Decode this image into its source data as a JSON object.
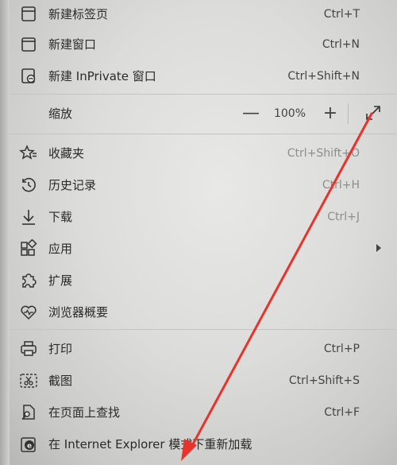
{
  "menu": {
    "items_top": [
      {
        "label": "新建标签页",
        "shortcut": "Ctrl+T"
      },
      {
        "label": "新建窗口",
        "shortcut": "Ctrl+N"
      },
      {
        "label": "新建 InPrivate 窗口",
        "shortcut": "Ctrl+Shift+N"
      }
    ],
    "zoom": {
      "label": "缩放",
      "minus": "—",
      "value": "100%",
      "plus": "+"
    },
    "items_mid": [
      {
        "label": "收藏夹",
        "shortcut": "Ctrl+Shift+O"
      },
      {
        "label": "历史记录",
        "shortcut": "Ctrl+H"
      },
      {
        "label": "下载",
        "shortcut": "Ctrl+J"
      },
      {
        "label": "应用",
        "shortcut": ""
      },
      {
        "label": "扩展",
        "shortcut": ""
      },
      {
        "label": "浏览器概要",
        "shortcut": ""
      }
    ],
    "items_bottom": [
      {
        "label": "打印",
        "shortcut": "Ctrl+P"
      },
      {
        "label": "截图",
        "shortcut": "Ctrl+Shift+S"
      },
      {
        "label": "在页面上查找",
        "shortcut": "Ctrl+F"
      },
      {
        "label": "在 Internet Explorer 模式下重新加载",
        "shortcut": ""
      }
    ]
  },
  "annotation": {
    "arrow_color": "#e8322a"
  }
}
